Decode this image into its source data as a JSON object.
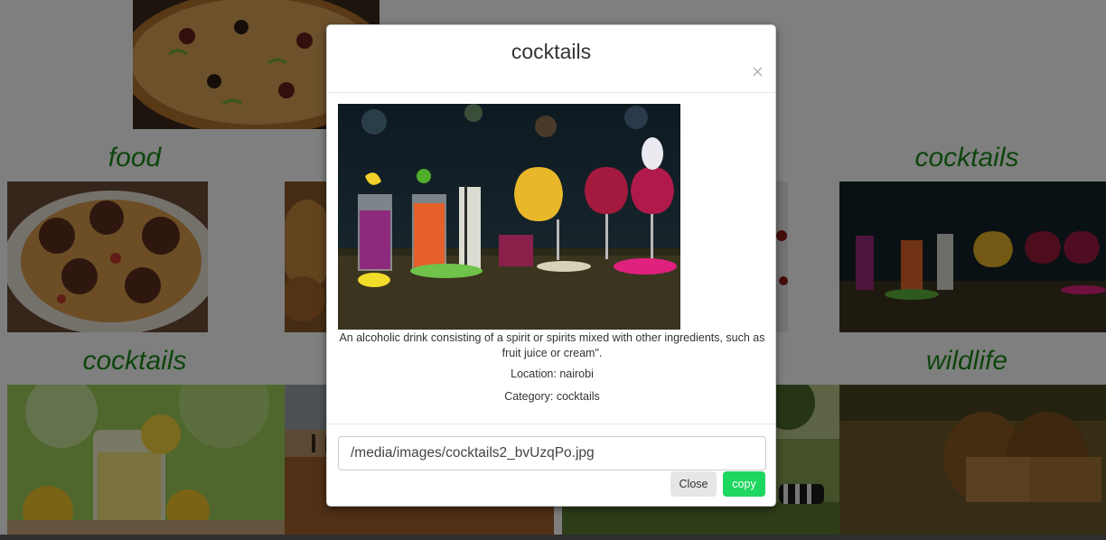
{
  "gallery": {
    "categories": [
      "food",
      "cocktails",
      "cocktails",
      "wildlife"
    ]
  },
  "modal": {
    "title": "cocktails",
    "close_icon": "×",
    "image_alt": "cocktails",
    "description": "An alcoholic drink consisting of a spirit or spirits mixed with other ingredients, such as fruit juice or cream\".",
    "location": "Location: nairobi",
    "category": "Category: cocktails",
    "image_path": "/media/images/cocktails2_bvUzqPo.jpg",
    "close_label": "Close",
    "copy_label": "copy"
  },
  "colors": {
    "title_green": "#1a8a1a",
    "copy_button": "#1ed760",
    "close_button": "#e6e6e6"
  }
}
